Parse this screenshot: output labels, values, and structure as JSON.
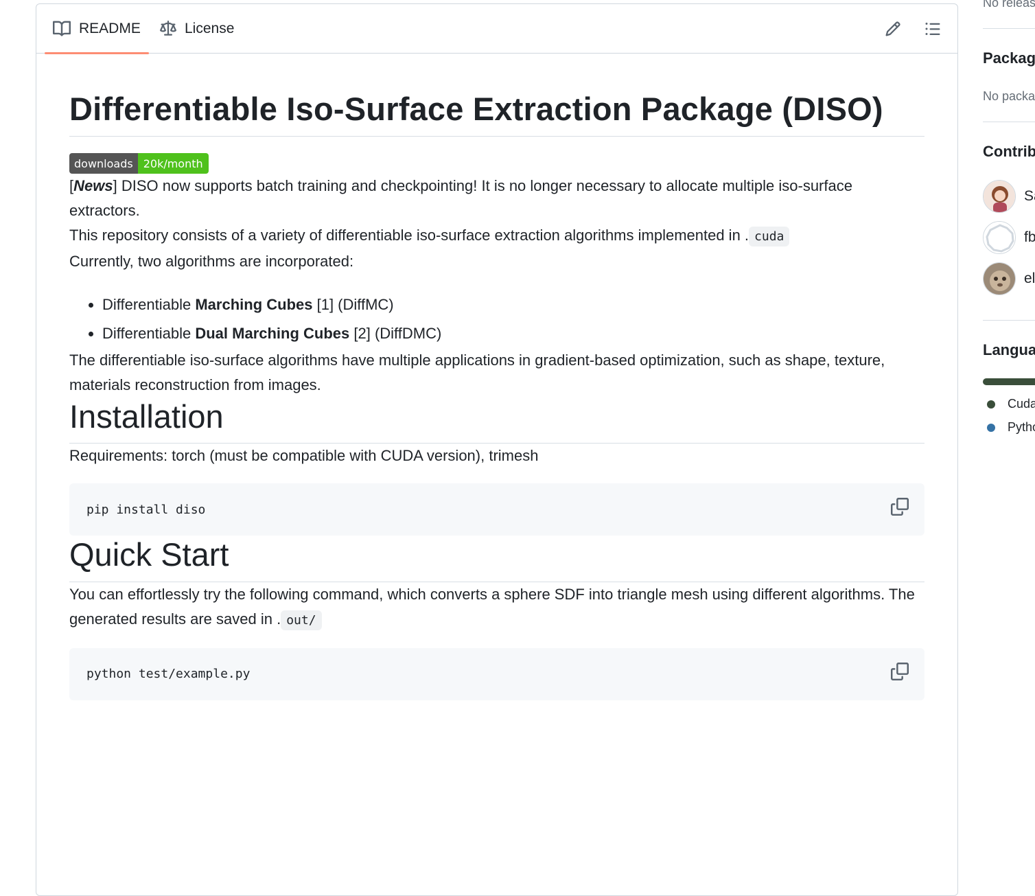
{
  "tabs": {
    "readme": "README",
    "license": "License"
  },
  "readme": {
    "title": "Differentiable Iso-Surface Extraction Package (DISO)",
    "badge": {
      "label": "downloads",
      "value": "20k/month",
      "label_color": "#555555",
      "value_color": "#4fc11c"
    },
    "news": {
      "open": "[",
      "tag": "News",
      "close": "]",
      "text": " DISO now supports batch training and checkpointing! It is no longer necessary to allocate multiple iso-surface extractors."
    },
    "repo_text": "This repository consists of a variety of differentiable iso-surface extraction algorithms implemented in .",
    "repo_code": "cuda",
    "currently": "Currently, two algorithms are incorporated:",
    "algorithms": [
      {
        "prefix": "Differentiable ",
        "bold": "Marching Cubes",
        "suffix": " [1] (DiffMC)"
      },
      {
        "prefix": "Differentiable ",
        "bold": "Dual Marching Cubes",
        "suffix": " [2] (DiffDMC)"
      }
    ],
    "applications": "The differentiable iso-surface algorithms have multiple applications in gradient-based optimization, such as shape, texture, materials reconstruction from images.",
    "installation": {
      "heading": "Installation",
      "requirements": "Requirements: torch (must be compatible with CUDA version), trimesh",
      "command": "pip install diso"
    },
    "quickstart": {
      "heading": "Quick Start",
      "text": "You can effortlessly try the following command, which converts a sphere SDF into triangle mesh using different algorithms. The generated results are saved in .",
      "code": "out/",
      "command": "python test/example.py"
    }
  },
  "sidebar": {
    "releases_empty": "No releases",
    "packages_heading": "Packages",
    "packages_empty": "No packages",
    "contributors_heading": "Contributors",
    "contributors": [
      {
        "name": "SarahWeiii"
      },
      {
        "name": "fbxiang"
      },
      {
        "name": "eliphatfs"
      }
    ],
    "languages_heading": "Languages",
    "languages": [
      {
        "name": "Cuda",
        "color": "#3a4e3a"
      },
      {
        "name": "Python",
        "color": "#3572A5"
      }
    ]
  },
  "icons": {
    "readme_tab": "book-icon",
    "license_tab": "law-icon",
    "edit": "pencil-icon",
    "toc": "list-unordered-icon",
    "copy": "copy-icon"
  }
}
